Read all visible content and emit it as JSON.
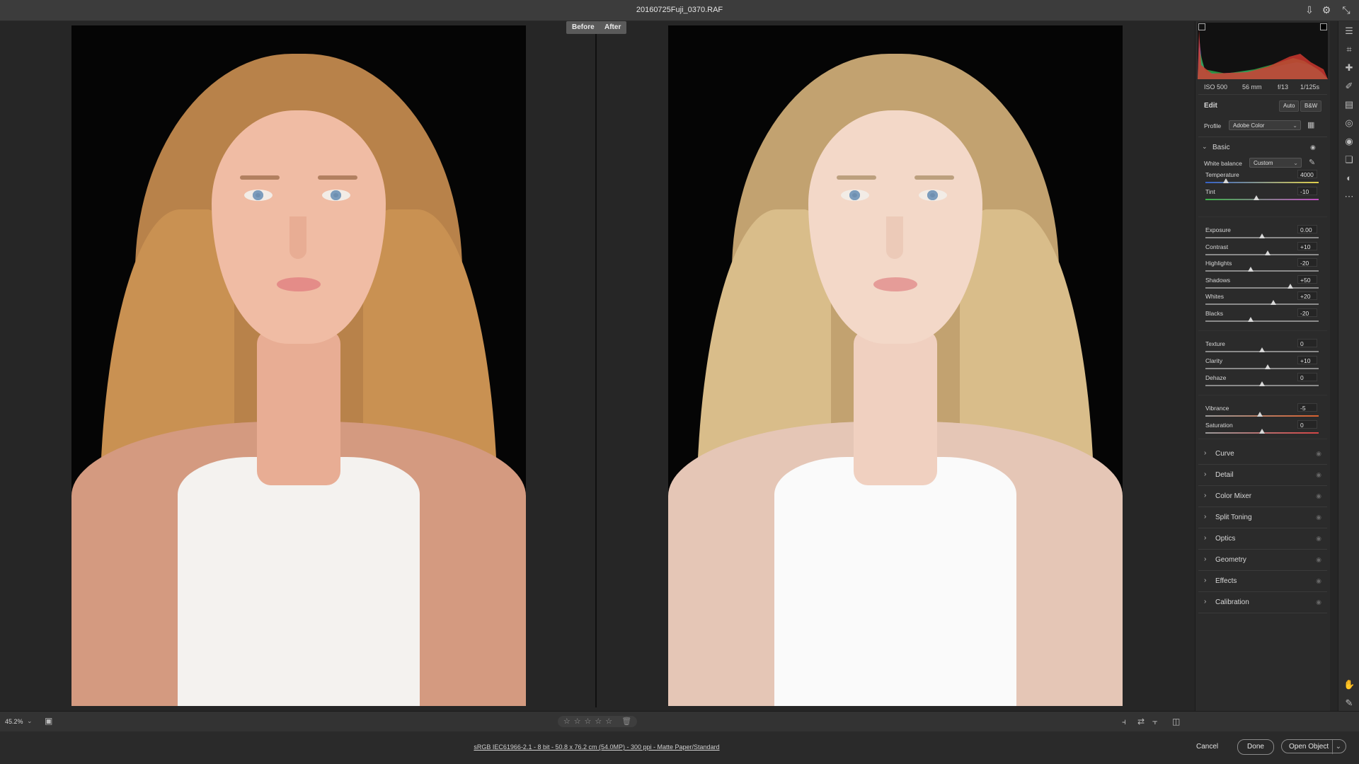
{
  "window": {
    "title": "20160725Fuji_0370.RAF",
    "icons": [
      "save-icon",
      "gear-icon",
      "collapse-icon"
    ]
  },
  "compare": {
    "before_label": "Before",
    "after_label": "After"
  },
  "histogram": {
    "iso": "ISO 500",
    "focal": "56 mm",
    "aperture": "f/13",
    "shutter": "1/125s"
  },
  "edit": {
    "title": "Edit",
    "auto_label": "Auto",
    "bw_label": "B&W",
    "profile_label": "Profile",
    "profile_value": "Adobe Color"
  },
  "basic": {
    "title": "Basic",
    "wb_label": "White balance",
    "wb_value": "Custom",
    "sliders": [
      {
        "label": "Temperature",
        "value": "4000",
        "pos": 0.18
      },
      {
        "label": "Tint",
        "value": "-10",
        "pos": 0.45
      },
      {
        "label": "Exposure",
        "value": "0.00",
        "pos": 0.5
      },
      {
        "label": "Contrast",
        "value": "+10",
        "pos": 0.55
      },
      {
        "label": "Highlights",
        "value": "-20",
        "pos": 0.4
      },
      {
        "label": "Shadows",
        "value": "+50",
        "pos": 0.75
      },
      {
        "label": "Whites",
        "value": "+20",
        "pos": 0.6
      },
      {
        "label": "Blacks",
        "value": "-20",
        "pos": 0.4
      },
      {
        "label": "Texture",
        "value": "0",
        "pos": 0.5
      },
      {
        "label": "Clarity",
        "value": "+10",
        "pos": 0.55
      },
      {
        "label": "Dehaze",
        "value": "0",
        "pos": 0.5
      },
      {
        "label": "Vibrance",
        "value": "-5",
        "pos": 0.48
      },
      {
        "label": "Saturation",
        "value": "0",
        "pos": 0.5
      }
    ]
  },
  "sections": [
    "Curve",
    "Detail",
    "Color Mixer",
    "Split Toning",
    "Optics",
    "Geometry",
    "Effects",
    "Calibration"
  ],
  "bottom": {
    "zoom": "45.2%",
    "stars": "☆☆☆☆☆",
    "file_info": "sRGB IEC61966-2.1 - 8 bit - 50.8 x 76.2 cm (54.0MP) - 300 ppi - Matte Paper/Standard",
    "cancel_label": "Cancel",
    "done_label": "Done",
    "open_label": "Open Object"
  },
  "colors": {
    "accent": "#5a5a5a",
    "panel": "#2b2b2b",
    "hair_before": "#d29a5a",
    "hair_after": "#d9bd8a",
    "skin_before": "#f0bca4",
    "skin_after": "#f3d8c8"
  }
}
